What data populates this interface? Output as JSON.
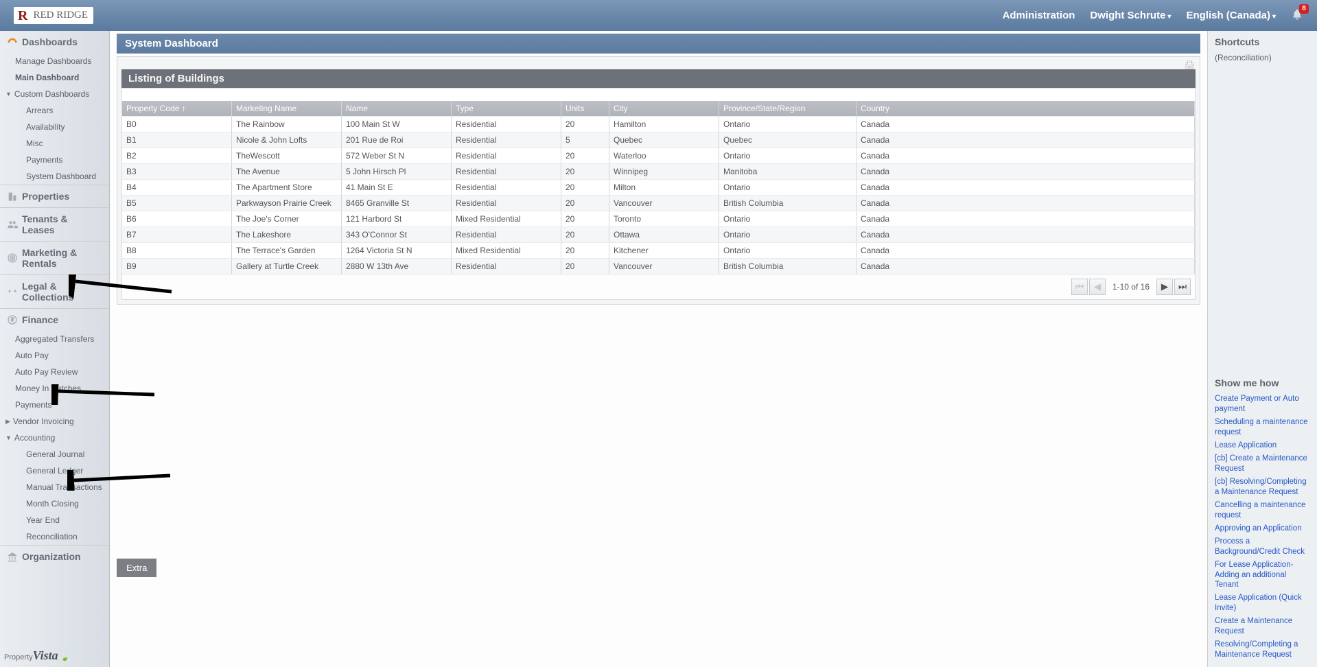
{
  "header": {
    "logo_text": "RED RIDGE",
    "nav": {
      "admin": "Administration",
      "user": "Dwight Schrute",
      "lang": "English (Canada)"
    },
    "notif_count": "8"
  },
  "sidebar": {
    "dashboards": {
      "label": "Dashboards",
      "items": [
        "Manage Dashboards",
        "Main Dashboard"
      ],
      "custom_label": "Custom Dashboards",
      "custom_items": [
        "Arrears",
        "Availability",
        "Misc",
        "Payments",
        "System Dashboard"
      ]
    },
    "properties": "Properties",
    "tenants": "Tenants & Leases",
    "marketing": "Marketing & Rentals",
    "legal": "Legal & Collections",
    "finance": {
      "label": "Finance",
      "items": [
        "Aggregated Transfers",
        "Auto Pay",
        "Auto Pay Review",
        "Money In Batches",
        "Payments"
      ],
      "vendor": "Vendor Invoicing",
      "accounting_label": "Accounting",
      "accounting_items": [
        "General Journal",
        "General Ledger",
        "Manual Transactions",
        "Month Closing",
        "Year End",
        "Reconciliation"
      ]
    },
    "organization": "Organization",
    "brand": "Property",
    "brand2": "Vista"
  },
  "main": {
    "title": "System Dashboard",
    "panel_title": "Listing of Buildings",
    "columns": {
      "pc": "Property Code ↑",
      "mn": "Marketing Name",
      "nm": "Name",
      "tp": "Type",
      "un": "Units",
      "ci": "City",
      "re": "Province/State/Region",
      "co": "Country"
    },
    "rows": [
      {
        "pc": "B0",
        "mn": "The Rainbow",
        "nm": "100 Main St W",
        "tp": "Residential",
        "un": "20",
        "ci": "Hamilton",
        "re": "Ontario",
        "co": "Canada"
      },
      {
        "pc": "B1",
        "mn": "Nicole & John Lofts",
        "nm": "201 Rue de Roi",
        "tp": "Residential",
        "un": "5",
        "ci": "Quebec",
        "re": "Quebec",
        "co": "Canada"
      },
      {
        "pc": "B2",
        "mn": "TheWescott",
        "nm": "572 Weber St N",
        "tp": "Residential",
        "un": "20",
        "ci": "Waterloo",
        "re": "Ontario",
        "co": "Canada"
      },
      {
        "pc": "B3",
        "mn": "The Avenue",
        "nm": "5 John Hirsch Pl",
        "tp": "Residential",
        "un": "20",
        "ci": "Winnipeg",
        "re": "Manitoba",
        "co": "Canada"
      },
      {
        "pc": "B4",
        "mn": "The Apartment Store",
        "nm": "41 Main St E",
        "tp": "Residential",
        "un": "20",
        "ci": "Milton",
        "re": "Ontario",
        "co": "Canada"
      },
      {
        "pc": "B5",
        "mn": "Parkwayson Prairie Creek",
        "nm": "8465 Granville St",
        "tp": "Residential",
        "un": "20",
        "ci": "Vancouver",
        "re": "British Columbia",
        "co": "Canada"
      },
      {
        "pc": "B6",
        "mn": "The Joe's Corner",
        "nm": "121 Harbord St",
        "tp": "Mixed Residential",
        "un": "20",
        "ci": "Toronto",
        "re": "Ontario",
        "co": "Canada"
      },
      {
        "pc": "B7",
        "mn": "The Lakeshore",
        "nm": "343 O'Connor St",
        "tp": "Residential",
        "un": "20",
        "ci": "Ottawa",
        "re": "Ontario",
        "co": "Canada"
      },
      {
        "pc": "B8",
        "mn": "The Terrace's Garden",
        "nm": "1264 Victoria St N",
        "tp": "Mixed Residential",
        "un": "20",
        "ci": "Kitchener",
        "re": "Ontario",
        "co": "Canada"
      },
      {
        "pc": "B9",
        "mn": "Gallery at Turtle Creek",
        "nm": "2880 W 13th Ave",
        "tp": "Residential",
        "un": "20",
        "ci": "Vancouver",
        "re": "British Columbia",
        "co": "Canada"
      }
    ],
    "pager_text": "1-10 of 16",
    "extra": "Extra"
  },
  "right": {
    "shortcuts_title": "Shortcuts",
    "shortcut_item": "(Reconciliation)",
    "show_title": "Show me how",
    "links": [
      "Create Payment or Auto payment",
      "Scheduling a maintenance request",
      "Lease Application",
      "[cb] Create a Maintenance Request",
      "[cb] Resolving/Completing a Maintenance Request",
      "Cancelling a maintenance request",
      "Approving an Application",
      "Process a Background/Credit Check",
      "For Lease Application-Adding an additional Tenant",
      "Lease Application (Quick Invite)",
      "Create a Maintenance Request",
      "Resolving/Completing a Maintenance Request"
    ]
  }
}
